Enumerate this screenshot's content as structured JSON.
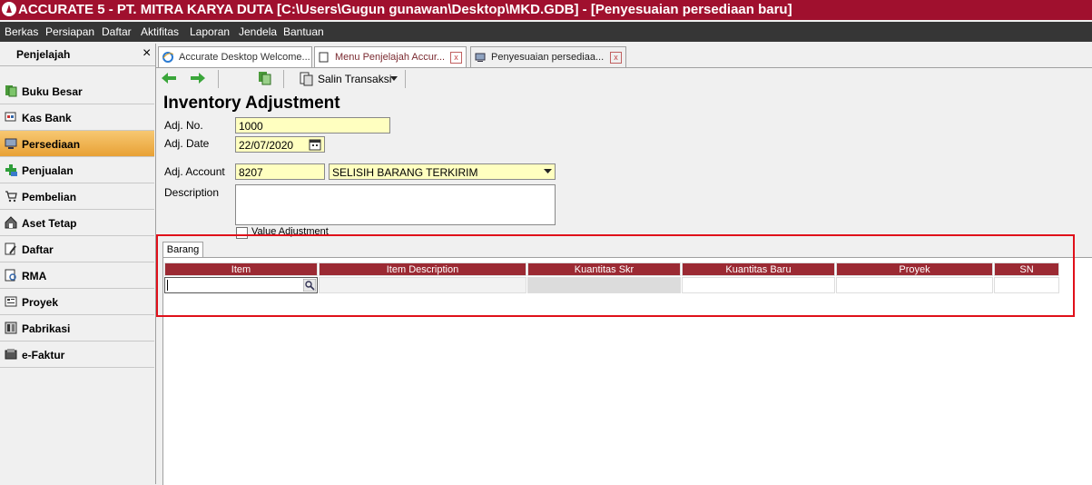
{
  "window": {
    "title": "ACCURATE 5  - PT. MITRA KARYA DUTA   [C:\\Users\\Gugun gunawan\\Desktop\\MKD.GDB] - [Penyesuaian persediaan baru]"
  },
  "menu": [
    "Berkas",
    "Persiapan",
    "Daftar",
    "Aktifitas",
    "Laporan",
    "Jendela",
    "Bantuan"
  ],
  "sidebar": {
    "title": "Penjelajah",
    "close_glyph": "×",
    "items": [
      {
        "label": "Buku Besar",
        "icon": "ledger-icon"
      },
      {
        "label": "Kas Bank",
        "icon": "bank-icon"
      },
      {
        "label": "Persediaan",
        "icon": "inventory-icon",
        "active": true
      },
      {
        "label": "Penjualan",
        "icon": "sales-icon"
      },
      {
        "label": "Pembelian",
        "icon": "cart-icon"
      },
      {
        "label": "Aset Tetap",
        "icon": "building-icon"
      },
      {
        "label": "Daftar",
        "icon": "list-icon"
      },
      {
        "label": "RMA",
        "icon": "rma-icon"
      },
      {
        "label": "Proyek",
        "icon": "project-icon"
      },
      {
        "label": "Pabrikasi",
        "icon": "factory-icon"
      },
      {
        "label": "e-Faktur",
        "icon": "efaktur-icon"
      }
    ]
  },
  "tabs": [
    {
      "label": "Accurate Desktop Welcome..."
    },
    {
      "label": "Menu Penjelajah Accur..."
    },
    {
      "label": "Penyesuaian persediaa..."
    }
  ],
  "toolbar": {
    "salin_label": "Salin Transaksi"
  },
  "form": {
    "title": "Inventory Adjustment",
    "adj_no_label": "Adj. No.",
    "adj_no": "1000",
    "adj_date_label": "Adj. Date",
    "adj_date": "22/07/2020",
    "adj_account_label": "Adj. Account",
    "adj_account_code": "8207",
    "adj_account_name": "SELISIH BARANG TERKIRIM",
    "description_label": "Description",
    "description": "",
    "value_adjustment_label": "Value Adjustment",
    "value_adjustment_checked": false
  },
  "grid": {
    "tab_label": "Barang",
    "columns": [
      "Item",
      "Item Description",
      "Kuantitas Skr",
      "Kuantitas Baru",
      "Proyek",
      "SN"
    ],
    "rows": [
      [
        "",
        "",
        "",
        "",
        "",
        ""
      ]
    ]
  },
  "colors": {
    "titlebar": "#a0102e",
    "menubar": "#363636",
    "grid_header": "#9b2a33",
    "field_bg": "#ffffc0",
    "highlight": "#e0101a",
    "active_item": "#e8a135"
  }
}
